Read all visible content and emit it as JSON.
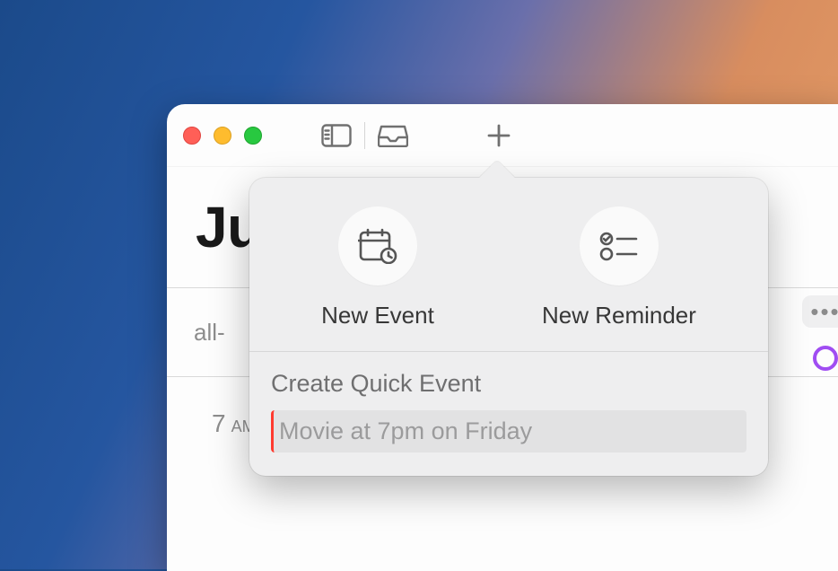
{
  "window": {
    "month_title_visible": "Ju"
  },
  "toolbar": {
    "sidebar_icon": "sidebar-toggle",
    "inbox_icon": "inbox",
    "add_icon": "plus"
  },
  "popover": {
    "new_event_label": "New Event",
    "new_reminder_label": "New Reminder",
    "quick_event_title": "Create Quick Event",
    "quick_event_placeholder": "Movie at 7pm on Friday"
  },
  "calendar": {
    "all_day_label_visible": "all-",
    "time_rows": [
      {
        "num": "7",
        "ampm": "AM"
      }
    ]
  },
  "colors": {
    "accent_purple": "#a04df2",
    "cursor_red": "#ff3b30"
  }
}
